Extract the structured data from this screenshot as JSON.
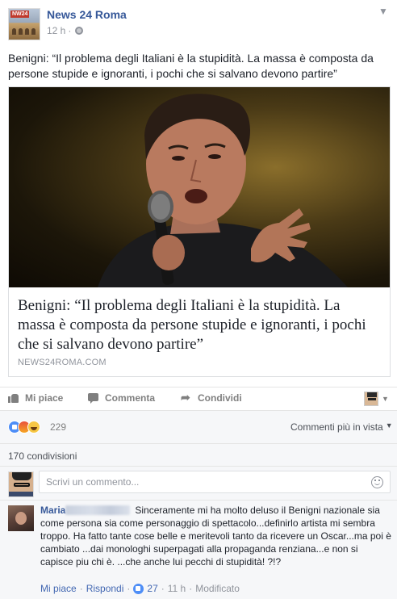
{
  "post": {
    "page_name": "News 24 Roma",
    "time": "12 h",
    "separator": "·",
    "text": "Benigni: “Il problema degli Italiani è la stupidità. La massa è composta da persone stupide e ignoranti, i pochi che si salvano devono partire”",
    "avatar_tag": "NW24"
  },
  "link_card": {
    "title": "Benigni: “Il problema degli Italiani è la stupidità. La massa è composta da persone stupide e ignoranti, i pochi che si salvano devono partire”",
    "domain": "NEWS24ROMA.COM"
  },
  "actions": {
    "like": "Mi piace",
    "comment": "Commenta",
    "share": "Condividi"
  },
  "reactions": {
    "count": "229",
    "sort_label": "Commenti più in vista"
  },
  "shares": {
    "label": "170 condivisioni"
  },
  "composer": {
    "placeholder": "Scrivi un commento..."
  },
  "comment": {
    "author": "Maria",
    "text": "Sinceramente mi ha molto deluso il Benigni nazionale sia come persona sia come personaggio di spettacolo...definirlo artista mi sembra troppo. Ha fatto tante cose belle e meritevoli tanto da ricevere un Oscar...ma poi è cambiato ...dai monologhi superpagati alla propaganda renziana...e non si capisce piu chi è. ...che anche lui pecchi di stupidità! ?!?",
    "like_link": "Mi piace",
    "reply_link": "Rispondi",
    "dot": "·",
    "like_count": "27",
    "time": "11 h",
    "edited": "Modificato"
  },
  "colors": {
    "link_blue": "#365899",
    "meta_gray": "#90949c",
    "background_gray": "#f6f7f9",
    "like_blue": "#4e8ef7"
  },
  "icons": [
    "chevron-down-icon",
    "globe-icon",
    "like-icon",
    "comment-icon",
    "share-icon",
    "emoji-icon"
  ]
}
